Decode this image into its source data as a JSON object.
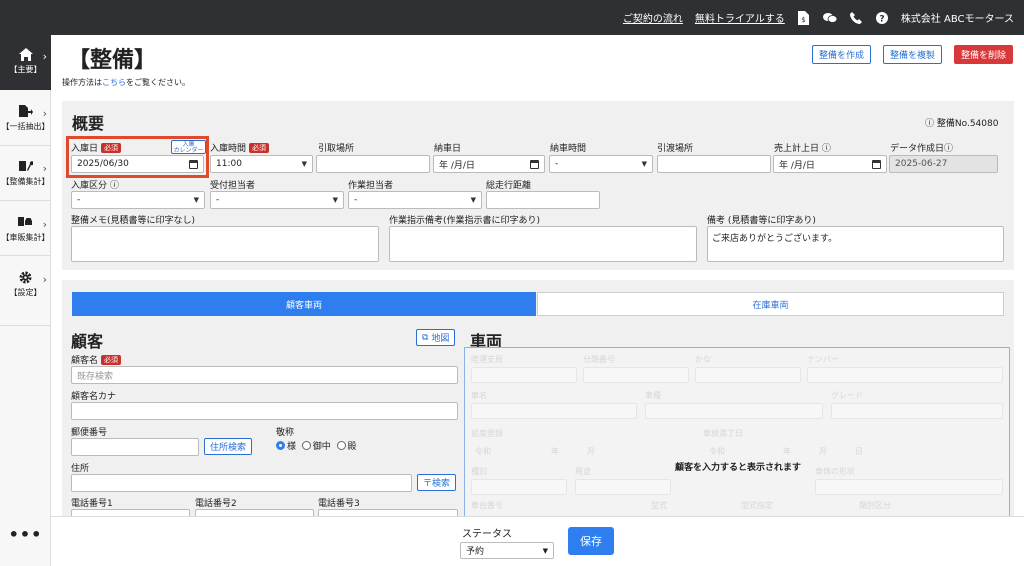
{
  "topbar": {
    "link_contract": "ご契約の流れ",
    "link_trial": "無料トライアルする",
    "company": "株式会社 ABCモータース",
    "icons": [
      "invoice-icon",
      "chat-icon",
      "phone-icon",
      "help-icon"
    ]
  },
  "sidebar": {
    "items": [
      {
        "label": "【主要】",
        "icon": "home-icon"
      },
      {
        "label": "【一括抽出】",
        "icon": "file-export-icon"
      },
      {
        "label": "【整備集計】",
        "icon": "wrench-icon"
      },
      {
        "label": "【車販集計】",
        "icon": "car-icon"
      },
      {
        "label": "【設定】",
        "icon": "gear-icon"
      }
    ],
    "more": "•••"
  },
  "header": {
    "title": "【整備】",
    "help_prefix": "操作方法は",
    "help_link": "こちら",
    "help_suffix": "をご覧ください。",
    "btn_create": "整備を作成",
    "btn_copy": "整備を複製",
    "btn_delete": "整備を削除"
  },
  "overview": {
    "title": "概要",
    "number": "整備No.54080",
    "required": "必須",
    "entry_date_label": "入庫日",
    "entry_date_value": "2025/06/30",
    "calendar_btn_line1": "入庫",
    "calendar_btn_line2": "カレンダー",
    "entry_time_label": "入庫時間",
    "entry_time_value": "11:00",
    "pickup_place_label": "引取場所",
    "delivery_date_label": "納車日",
    "date_placeholder": "年 /月/日",
    "delivery_time_label": "納車時間",
    "dash": "-",
    "handover_place_label": "引渡場所",
    "sales_date_label": "売上計上日",
    "data_created_label": "データ作成日",
    "data_created_value": "2025-06-27",
    "entry_type_label": "入庫区分",
    "receptionist_label": "受付担当者",
    "worker_label": "作業担当者",
    "mileage_label": "総走行距離",
    "memo_label": "整備メモ(見積書等に印字なし)",
    "work_note_label": "作業指示備考(作業指示書に印字あり)",
    "remarks_label": "備考 (見積書等に印字あり)",
    "remarks_value": "ご来店ありがとうございます。"
  },
  "tabs": {
    "customer_vehicle": "顧客車両",
    "stock_vehicle": "在庫車両"
  },
  "customer": {
    "title": "顧客",
    "map_btn": "地図",
    "name_label": "顧客名",
    "name_placeholder": "既存検索",
    "kana_label": "顧客名カナ",
    "postal_label": "郵便番号",
    "address_search_btn": "住所検索",
    "honorific_label": "敬称",
    "honorific_options": [
      "様",
      "御中",
      "殿"
    ],
    "address_label": "住所",
    "postal_search_btn": "〒検索",
    "phone1_label": "電話番号1",
    "phone2_label": "電話番号2",
    "phone3_label": "電話番号3"
  },
  "vehicle": {
    "title": "車両",
    "empty_message": "顧客を入力すると表示されます",
    "ghost_labels": [
      "陸運支局",
      "分類番号",
      "かな",
      "ナンバー",
      "車名",
      "車種",
      "グレード",
      "初度登録",
      "令和",
      "年",
      "月",
      "車検満了日",
      "令和",
      "年",
      "月",
      "日",
      "種別",
      "用途",
      "車体の形状",
      "車台番号",
      "型式",
      "型式指定",
      "類別区分"
    ]
  },
  "footer": {
    "status_label": "ステータス",
    "status_value": "予約",
    "save_label": "保存"
  }
}
